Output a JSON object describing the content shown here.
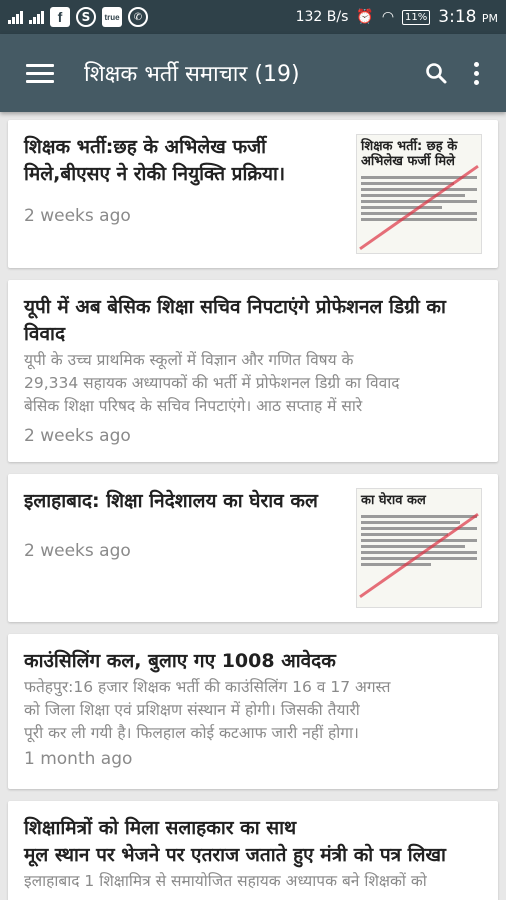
{
  "status": {
    "net_speed": "132 B/s",
    "battery": "11%",
    "time": "3:18",
    "ampm": "PM",
    "truecaller_label": "true"
  },
  "app_bar": {
    "title": "शिक्षक भर्ती समाचार (19)"
  },
  "articles": [
    {
      "title": "शिक्षक भर्ती:छह के अभिलेख फर्जी मिले,बीएसए ने रोकी नियुक्ति प्रक्रिया।",
      "excerpt": "",
      "time": "2 weeks ago",
      "thumb_text": "शिक्षक भर्ती: छह के अभिलेख फर्जी मिले"
    },
    {
      "title": "यूपी में अब बेसिक शिक्षा सचिव निपटाएंगे प्रोफेशनल डिग्री का विवाद",
      "excerpt": "यूपी के उच्च प्राथमिक स्कूलों में विज्ञान और गणित विषय के\n29,334 सहायक अध्यापकों की भर्ती में प्रोफेशनल डिग्री का विवाद\nबेसिक शिक्षा परिषद के सचिव निपटाएंगे। आठ सप्ताह में सारे",
      "time": "2 weeks ago"
    },
    {
      "title": "इलाहाबाद: शिक्षा निदेशालय का घेराव कल",
      "excerpt": "",
      "time": "2 weeks ago",
      "thumb_text": "का घेराव कल"
    },
    {
      "title": "काउंसिलिंग कल, बुलाए गए 1008 आवेदक",
      "excerpt": "फतेहपुर:16 हजार शिक्षक भर्ती की काउंसिलिंग 16 व 17 अगस्त\nको जिला शिक्षा एवं प्रशिक्षण संस्थान में होगी। जिसकी तैयारी\nपूरी कर ली गयी है। फिलहाल कोई कटआफ जारी नहीं होगा।",
      "time": "1 month ago"
    },
    {
      "title": "शिक्षामित्रों को मिला सलाहकार का साथ\nमूल स्थान पर भेजने पर एतराज जताते हुए मंत्री को पत्र लिखा",
      "excerpt": "इलाहाबाद 1 शिक्षामित्र से समायोजित सहायक अध्यापक बने शिक्षकों को",
      "time": ""
    }
  ]
}
